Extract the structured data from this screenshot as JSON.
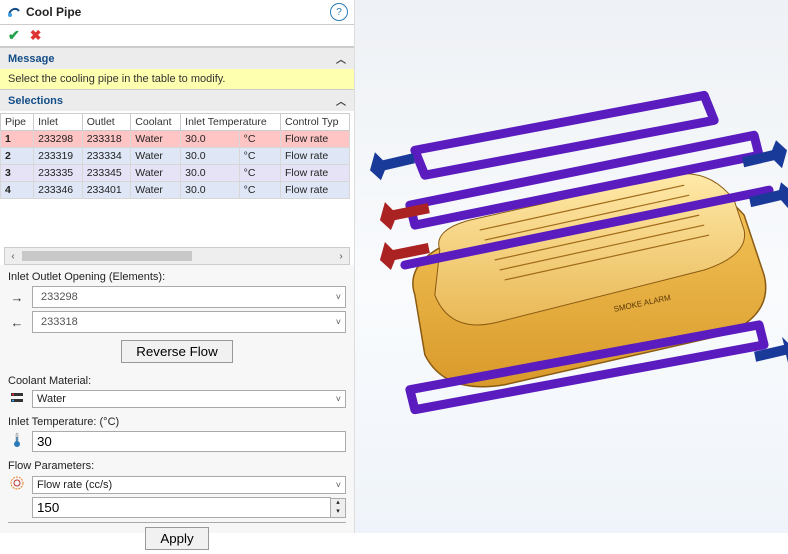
{
  "title": "Cool Pipe",
  "sections": {
    "message": {
      "head": "Message",
      "body": "Select the cooling pipe in the table to modify."
    },
    "selections": {
      "head": "Selections"
    }
  },
  "columns": [
    "Pipe",
    "Inlet",
    "Outlet",
    "Coolant",
    "Inlet Temperature",
    "Control Typ"
  ],
  "rows": [
    {
      "pipe": "1",
      "inlet": "233298",
      "outlet": "233318",
      "coolant": "Water",
      "temp": "30.0",
      "unit": "°C",
      "ctrl": "Flow rate"
    },
    {
      "pipe": "2",
      "inlet": "233319",
      "outlet": "233334",
      "coolant": "Water",
      "temp": "30.0",
      "unit": "°C",
      "ctrl": "Flow rate"
    },
    {
      "pipe": "3",
      "inlet": "233335",
      "outlet": "233345",
      "coolant": "Water",
      "temp": "30.0",
      "unit": "°C",
      "ctrl": "Flow rate"
    },
    {
      "pipe": "4",
      "inlet": "233346",
      "outlet": "233401",
      "coolant": "Water",
      "temp": "30.0",
      "unit": "°C",
      "ctrl": "Flow rate"
    }
  ],
  "io": {
    "label": "Inlet Outlet Opening (Elements):",
    "inlet": "233298",
    "outlet": "233318",
    "reverse": "Reverse Flow"
  },
  "coolant": {
    "label": "Coolant Material:",
    "value": "Water"
  },
  "temp": {
    "label": "Inlet Temperature: (°C)",
    "value": "30"
  },
  "flow": {
    "label": "Flow Parameters:",
    "type": "Flow rate (cc/s)",
    "value": "150"
  },
  "apply": "Apply",
  "model_label": "SMOKE ALARM"
}
